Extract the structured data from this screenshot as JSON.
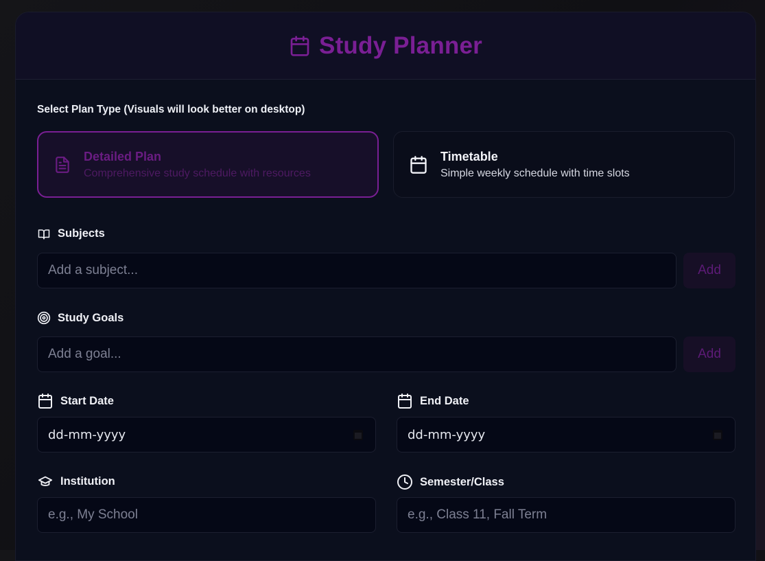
{
  "header": {
    "title": "Study Planner",
    "icon": "calendar-icon"
  },
  "plan_type": {
    "label": "Select Plan Type (Visuals will look better on desktop)",
    "options": [
      {
        "title": "Detailed Plan",
        "description": "Comprehensive study schedule with resources",
        "icon": "document-icon",
        "selected": true
      },
      {
        "title": "Timetable",
        "description": "Simple weekly schedule with time slots",
        "icon": "calendar-icon",
        "selected": false
      }
    ]
  },
  "subjects": {
    "label": "Subjects",
    "placeholder": "Add a subject...",
    "add_label": "Add",
    "icon": "book-icon"
  },
  "goals": {
    "label": "Study Goals",
    "placeholder": "Add a goal...",
    "add_label": "Add",
    "icon": "target-icon"
  },
  "start_date": {
    "label": "Start Date",
    "value": "dd-mm-yyyy",
    "icon": "calendar-icon"
  },
  "end_date": {
    "label": "End Date",
    "value": "dd-mm-yyyy",
    "icon": "calendar-icon"
  },
  "institution": {
    "label": "Institution",
    "placeholder": "e.g., My School",
    "icon": "graduation-cap-icon"
  },
  "semester": {
    "label": "Semester/Class",
    "placeholder": "e.g., Class 11, Fall Term",
    "icon": "clock-icon"
  },
  "colors": {
    "accent": "#7a1f94",
    "background": "#0b0f1d",
    "input_bg": "#050816"
  }
}
